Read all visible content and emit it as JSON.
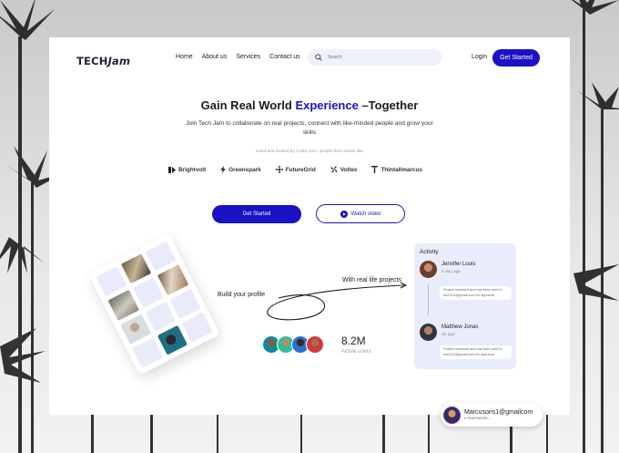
{
  "brand": {
    "name_part1": "TECH",
    "name_part2": "Jam",
    "accent_color": "#1a12c4"
  },
  "nav": {
    "items": [
      {
        "label": "Home"
      },
      {
        "label": "About us"
      },
      {
        "label": "Services"
      },
      {
        "label": "Contact us"
      }
    ],
    "search_placeholder": "Search",
    "login_label": "Login",
    "cta_label": "Get Started"
  },
  "hero": {
    "headline_pre": "Gain Real World ",
    "headline_accent": "Experience",
    "headline_post": " –Together",
    "subtitle": "Join Tech Jam to collaborate on real projects, connect with like-minded people and grow your skills",
    "trust_text": "Used and trusted by 2,563,101+ people from teams like",
    "brands": [
      {
        "name": "Brightvolt",
        "icon": "brightvolt-icon"
      },
      {
        "name": "Greenspark",
        "icon": "bolt-icon"
      },
      {
        "name": "FutureGrid",
        "icon": "grid-gear-icon"
      },
      {
        "name": "Voltex",
        "icon": "fan-icon"
      },
      {
        "name": "Thintallmarcus",
        "icon": "t-icon"
      }
    ],
    "cta_label": "Get Started",
    "watch_label": "Watch video"
  },
  "showcase": {
    "build_label": "Build your profile",
    "real_label": "With real life projects",
    "stat_value": "8.2M",
    "stat_label": "Active users"
  },
  "activity": {
    "title": "Activity",
    "entries": [
      {
        "name": "Jennifer Louis",
        "time": "1 day ago",
        "note": "Project reviewed and has been sent to tim2314@gmail.com for approval"
      },
      {
        "name": "Matthew Jonas",
        "time": "4h ago",
        "note": "Project reviewed and has been sent to tim2314@gmail.com for approval"
      }
    ]
  },
  "user_pill": {
    "name": "Marcusoris1@gmailcom",
    "handle": "x marcusoris..."
  }
}
